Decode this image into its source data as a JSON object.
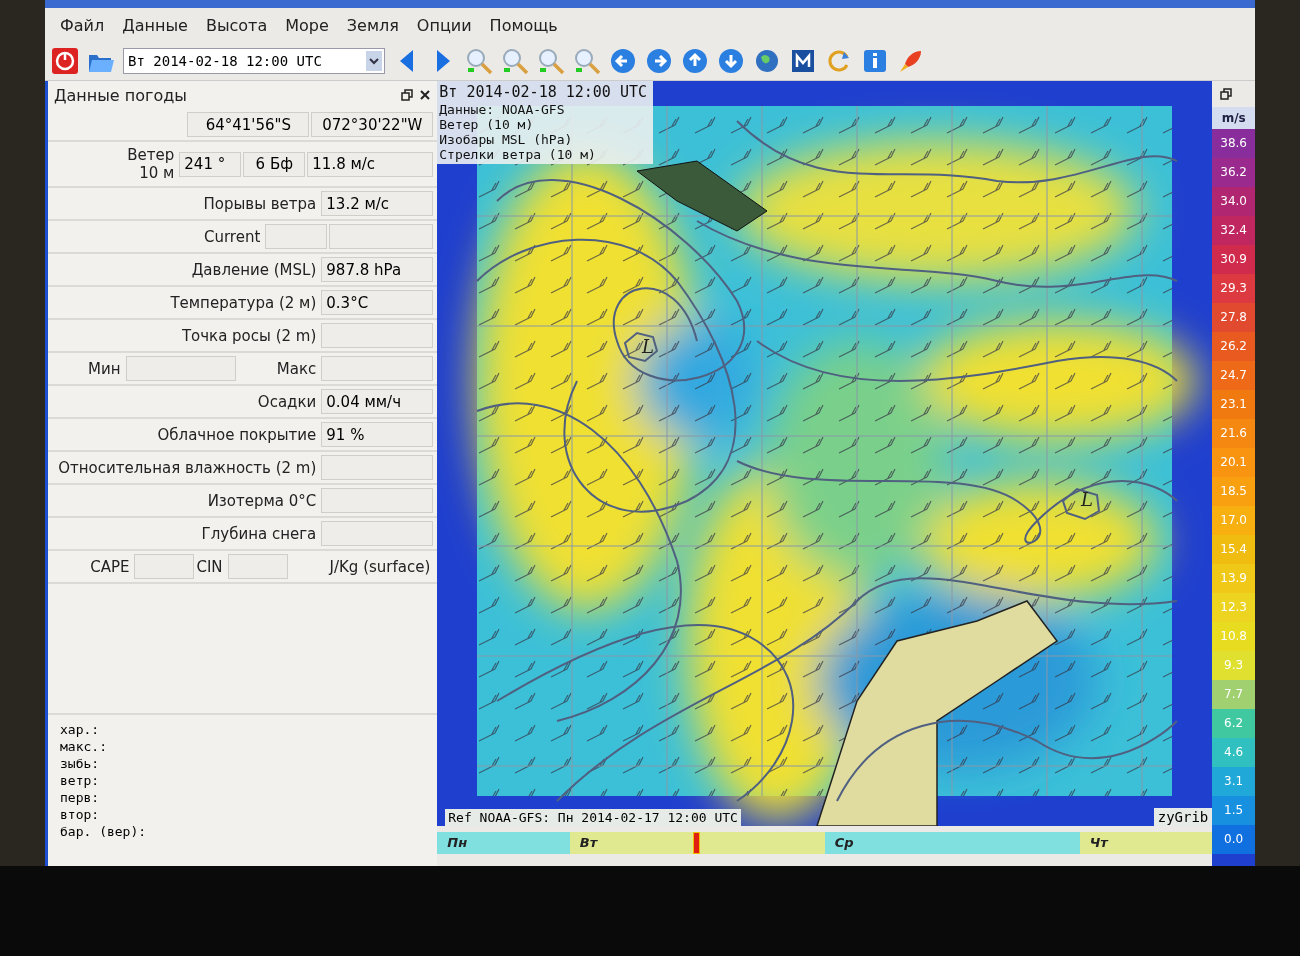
{
  "menu": [
    "Файл",
    "Данные",
    "Высота",
    "Море",
    "Земля",
    "Опции",
    "Помощь"
  ],
  "toolbar": {
    "date_select": {
      "value": "Вт 2014-02-18 12:00 UTC"
    }
  },
  "weather_panel": {
    "title": "Данные погоды",
    "rows": [
      {
        "kind": "coords",
        "values": [
          "64°41'56\"S",
          "072°30'22\"W"
        ]
      },
      {
        "kind": "wind",
        "labels": [
          "Ветер",
          "10 м"
        ],
        "values": [
          "241 °",
          "6 Бф",
          "11.8  м/с"
        ]
      },
      {
        "kind": "pair",
        "labels": [
          "Порывы ветра"
        ],
        "values": [
          "13.2  м/с"
        ]
      },
      {
        "kind": "double",
        "labels": [
          "Current"
        ],
        "values": []
      },
      {
        "kind": "pair",
        "labels": [
          "Давление (MSL)"
        ],
        "values": [
          "987.8 hPa"
        ]
      },
      {
        "kind": "pair",
        "labels": [
          "Температура (2 м)"
        ],
        "values": [
          "0.3°C"
        ]
      },
      {
        "kind": "pair",
        "labels": [
          "Точка росы (2 m)"
        ],
        "values": []
      },
      {
        "kind": "minmax",
        "labels": [
          "Мин",
          "Макс"
        ],
        "values": []
      },
      {
        "kind": "pair",
        "labels": [
          "Осадки"
        ],
        "values": [
          "0.04 мм/ч"
        ]
      },
      {
        "kind": "pair",
        "labels": [
          "Облачное покрытие"
        ],
        "values": [
          "91 %"
        ]
      },
      {
        "kind": "pair",
        "labels": [
          "Относительная влажность (2 m)"
        ],
        "values": []
      },
      {
        "kind": "pair",
        "labels": [
          "Изотерма 0°C"
        ],
        "values": []
      },
      {
        "kind": "pair",
        "labels": [
          "Глубина снега"
        ],
        "values": []
      },
      {
        "kind": "cape",
        "labels": [
          "CAPE",
          "CIN",
          "J/Kg (surface)"
        ],
        "values": []
      }
    ],
    "notes": [
      "хар.:",
      "макс.:",
      "зыбь:",
      "ветр:",
      "перв:",
      "втор:",
      "бар. (вер):"
    ]
  },
  "map": {
    "info_lines": [
      "Вт 2014-02-18 12:00 UTC",
      "Данные: NOAA-GFS",
      "Ветер (10 м)",
      "Изобары MSL (hPa)",
      "Стрелки ветра (10 м)"
    ],
    "pressure_labels": [
      "L",
      "L"
    ],
    "reference": "Ref NOAA-GFS: Пн 2014-02-17 12:00 UTC",
    "credit": "zyGrib"
  },
  "legend": {
    "unit": "m/s",
    "items": [
      {
        "label": "38.6",
        "color": "#8a2d9c"
      },
      {
        "label": "36.2",
        "color": "#9b2a8e"
      },
      {
        "label": "34.0",
        "color": "#b02670"
      },
      {
        "label": "32.4",
        "color": "#c02660"
      },
      {
        "label": "30.9",
        "color": "#d02a4c"
      },
      {
        "label": "29.3",
        "color": "#dc3a40"
      },
      {
        "label": "27.8",
        "color": "#e24a30"
      },
      {
        "label": "26.2",
        "color": "#e85a20"
      },
      {
        "label": "24.7",
        "color": "#ee6a18"
      },
      {
        "label": "23.1",
        "color": "#f07a10"
      },
      {
        "label": "21.6",
        "color": "#f48810"
      },
      {
        "label": "20.1",
        "color": "#f89410"
      },
      {
        "label": "18.5",
        "color": "#f8a010"
      },
      {
        "label": "17.0",
        "color": "#f8b010"
      },
      {
        "label": "15.4",
        "color": "#f0bc10"
      },
      {
        "label": "13.9",
        "color": "#f0c818"
      },
      {
        "label": "12.3",
        "color": "#ecd420"
      },
      {
        "label": "10.8",
        "color": "#e8dc20"
      },
      {
        "label": "9.3",
        "color": "#e0e030"
      },
      {
        "label": "7.7",
        "color": "#a0d070"
      },
      {
        "label": "6.2",
        "color": "#40c8a0"
      },
      {
        "label": "4.6",
        "color": "#30c0c0"
      },
      {
        "label": "3.1",
        "color": "#20a8d8"
      },
      {
        "label": "1.5",
        "color": "#1890e0"
      },
      {
        "label": "0.0",
        "color": "#1070e0"
      }
    ]
  },
  "timeline": {
    "level": 0.33,
    "days": [
      {
        "label": "Пн",
        "color": "#80e0e0"
      },
      {
        "label": "Вт",
        "color": "#e0e890"
      },
      {
        "label": "Ср",
        "color": "#80e0e0"
      },
      {
        "label": "Чт",
        "color": "#e0e890"
      }
    ]
  }
}
